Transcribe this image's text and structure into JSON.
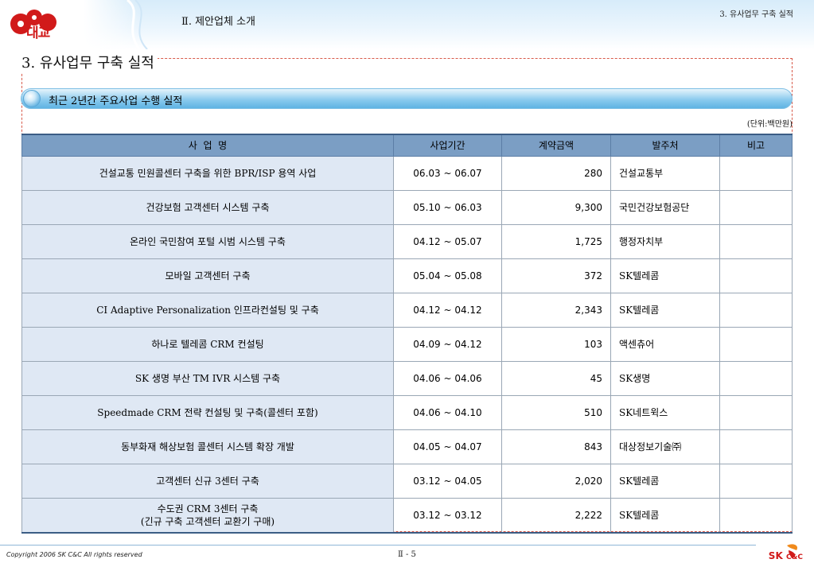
{
  "header": {
    "logo_text": "대교",
    "section_title": "Ⅱ. 제안업체 소개",
    "corner_title": "3. 유사업무 구축 실적"
  },
  "page_title": "3. 유사업무 구축 실적",
  "subheading": "최근 2년간 주요사업 수행 실적",
  "unit": "(단위:백만원)",
  "table": {
    "headers": [
      "사  업  명",
      "사업기간",
      "계약금액",
      "발주처",
      "비고"
    ],
    "rows": [
      {
        "name": "건설교통 민원콜센터 구축을 위한 BPR/ISP 용역 사업",
        "name2": "",
        "period": "06.03 ~ 06.07",
        "amount": "280",
        "client": "건설교통부",
        "note": ""
      },
      {
        "name": "건강보험 고객센터 시스템 구축",
        "name2": "",
        "period": "05.10 ~ 06.03",
        "amount": "9,300",
        "client": "국민건강보험공단",
        "note": ""
      },
      {
        "name": "온라인 국민참여 포털 시범 시스템 구축",
        "name2": "",
        "period": "04.12 ~ 05.07",
        "amount": "1,725",
        "client": "행정자치부",
        "note": ""
      },
      {
        "name": "모바일 고객센터 구축",
        "name2": "",
        "period": "05.04 ~ 05.08",
        "amount": "372",
        "client": "SK텔레콤",
        "note": ""
      },
      {
        "name": "CI Adaptive Personalization 인프라컨설팅 및 구축",
        "name2": "",
        "period": "04.12 ~ 04.12",
        "amount": "2,343",
        "client": "SK텔레콤",
        "note": ""
      },
      {
        "name": "하나로 텔레콤 CRM 컨설팅",
        "name2": "",
        "period": "04.09 ~ 04.12",
        "amount": "103",
        "client": "액센츄어",
        "note": ""
      },
      {
        "name": "SK 생명 부산 TM IVR 시스템 구축",
        "name2": "",
        "period": "04.06 ~ 04.06",
        "amount": "45",
        "client": "SK생명",
        "note": ""
      },
      {
        "name": "Speedmade CRM 전략 컨설팅 및 구축(콜센터 포함)",
        "name2": "",
        "period": "04.06 ~ 04.10",
        "amount": "510",
        "client": "SK네트윅스",
        "note": ""
      },
      {
        "name": "동부화재 해상보험 콜센터 시스템 확장 개발",
        "name2": "",
        "period": "04.05 ~ 04.07",
        "amount": "843",
        "client": "대상정보기술㈜",
        "note": ""
      },
      {
        "name": "고객센터 신규 3센터 구축",
        "name2": "",
        "period": "03.12 ~ 04.05",
        "amount": "2,020",
        "client": "SK텔레콤",
        "note": ""
      },
      {
        "name": "수도권 CRM 3센터 구축",
        "name2": "(긴규 구축 고객센터 교환기 구매)",
        "period": "03.12 ~ 03.12",
        "amount": "2,222",
        "client": "SK텔레콤",
        "note": ""
      }
    ]
  },
  "footer": {
    "copyright": "Copyright 2006 SK C&C All rights reserved",
    "page_number": "Ⅱ - 5",
    "brand_main": "SK",
    "brand_sub": "C&C"
  },
  "colors": {
    "header_bg": "#d7ecfa",
    "table_header": "#7b9ec4",
    "name_cell": "#dfe8f4",
    "accent_red": "#d11a1a",
    "frame_dash": "#d85a4a"
  }
}
